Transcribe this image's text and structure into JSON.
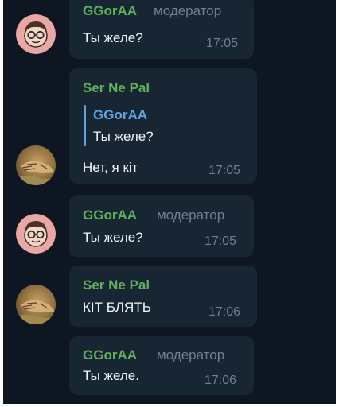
{
  "messages": [
    {
      "author": "GGorAA",
      "role": "модератор",
      "text": "Ты желе?",
      "time": "17:05",
      "avatar": "glasses-face-avatar"
    },
    {
      "author": "Ser Ne Pal",
      "reply": {
        "author": "GGorAA",
        "text": "Ты желе?"
      },
      "text": "Нет, я кіт",
      "time": "17:05",
      "avatar": "cat-photo-avatar"
    },
    {
      "author": "GGorAA",
      "role": "модератор",
      "text": "Ты желе?",
      "time": "17:05",
      "avatar": "glasses-face-avatar"
    },
    {
      "author": "Ser Ne Pal",
      "text": "КІТ БЛЯТЬ",
      "time": "17:06",
      "avatar": "cat-photo-avatar"
    },
    {
      "author": "GGorAA",
      "role": "модератор",
      "text": "Ты желе.",
      "time": "17:06"
    }
  ],
  "colors": {
    "background": "#0e1621",
    "bubble": "#182533",
    "name_green": "#5fb05b",
    "reply_blue": "#5ea2e0",
    "meta_gray": "#6f8090"
  }
}
